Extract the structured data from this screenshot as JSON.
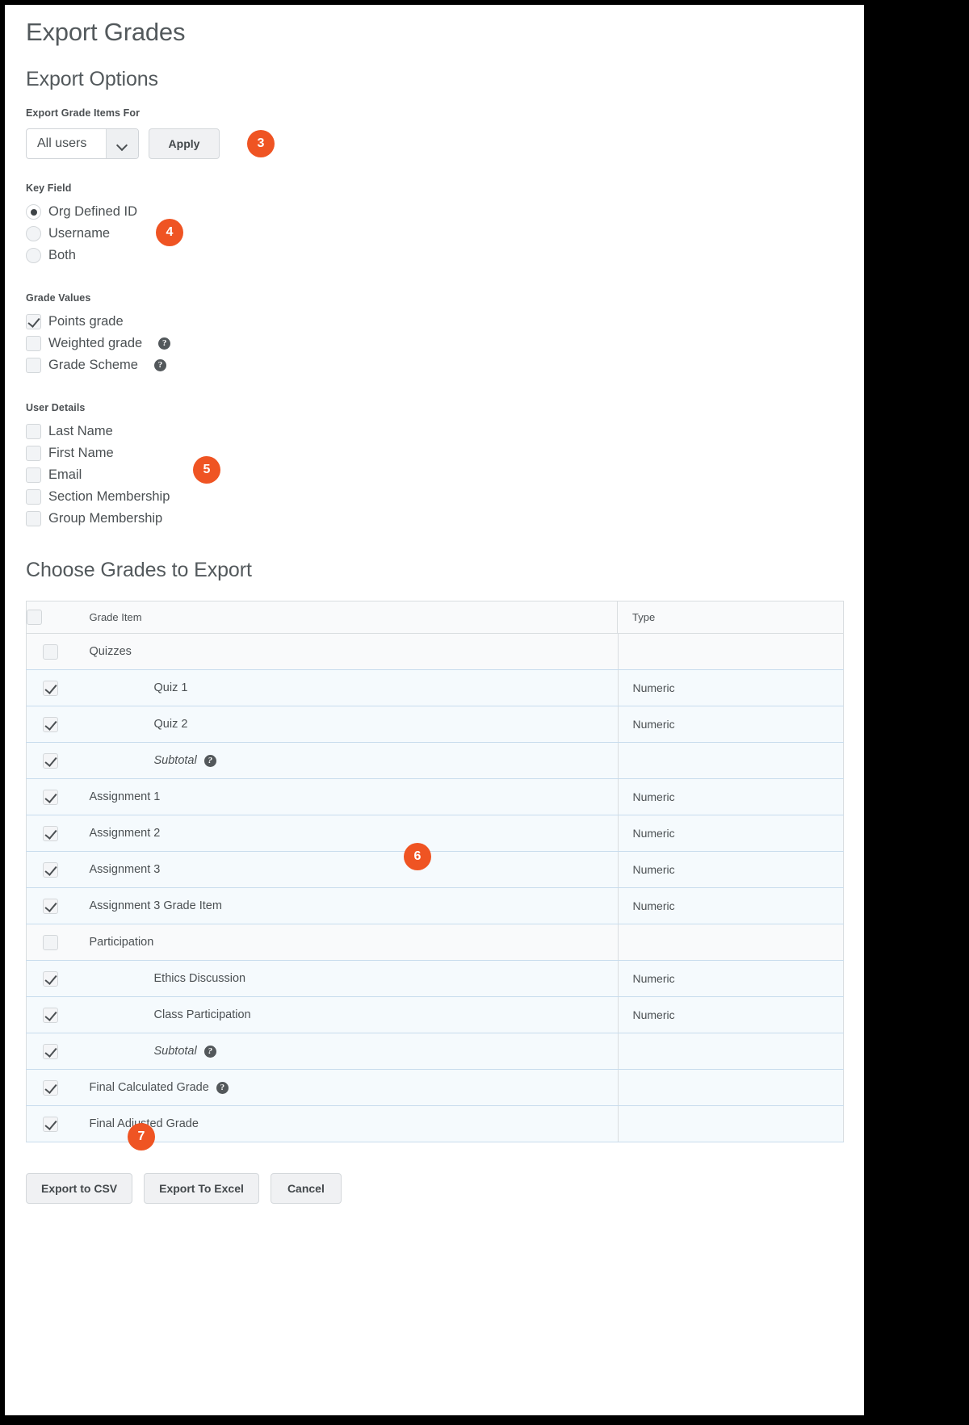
{
  "page": {
    "title": "Export Grades",
    "section_title": "Export Options",
    "choose_title": "Choose Grades to Export"
  },
  "colors": {
    "badge": "#ef5423",
    "text": "#4b5053",
    "row_highlight": "#f5fafd",
    "row_category": "#f9fafb"
  },
  "export_options": {
    "export_for_label": "Export Grade Items For",
    "select_value": "All users",
    "select_options": [
      "All users"
    ],
    "apply_label": "Apply",
    "badge_3": "3",
    "key_field": {
      "label": "Key Field",
      "badge_4": "4",
      "options": [
        {
          "label": "Org Defined ID",
          "selected": true
        },
        {
          "label": "Username",
          "selected": false
        },
        {
          "label": "Both",
          "selected": false
        }
      ]
    },
    "grade_values": {
      "label": "Grade Values",
      "options": [
        {
          "label": "Points grade",
          "checked": true,
          "help": false
        },
        {
          "label": "Weighted grade",
          "checked": false,
          "help": true
        },
        {
          "label": "Grade Scheme",
          "checked": false,
          "help": true
        }
      ]
    },
    "user_details": {
      "label": "User Details",
      "badge_5": "5",
      "options": [
        {
          "label": "Last Name",
          "checked": false
        },
        {
          "label": "First Name",
          "checked": false
        },
        {
          "label": "Email",
          "checked": false
        },
        {
          "label": "Section Membership",
          "checked": false
        },
        {
          "label": "Group Membership",
          "checked": false
        }
      ]
    }
  },
  "grades_table": {
    "badge_6": "6",
    "headers": {
      "check": "",
      "grade_item": "Grade Item",
      "type": "Type"
    },
    "header_check_checked": false,
    "rows": [
      {
        "name": "Quizzes",
        "type": "",
        "checked": false,
        "indent": 0,
        "kind": "category",
        "help": false,
        "italic": false
      },
      {
        "name": "Quiz 1",
        "type": "Numeric",
        "checked": true,
        "indent": 1,
        "kind": "item",
        "help": false,
        "italic": false
      },
      {
        "name": "Quiz 2",
        "type": "Numeric",
        "checked": true,
        "indent": 1,
        "kind": "item",
        "help": false,
        "italic": false
      },
      {
        "name": "Subtotal",
        "type": "",
        "checked": true,
        "indent": 1,
        "kind": "item",
        "help": true,
        "italic": true
      },
      {
        "name": "Assignment 1",
        "type": "Numeric",
        "checked": true,
        "indent": 0,
        "kind": "item",
        "help": false,
        "italic": false
      },
      {
        "name": "Assignment 2",
        "type": "Numeric",
        "checked": true,
        "indent": 0,
        "kind": "item",
        "help": false,
        "italic": false
      },
      {
        "name": "Assignment 3",
        "type": "Numeric",
        "checked": true,
        "indent": 0,
        "kind": "item",
        "help": false,
        "italic": false
      },
      {
        "name": "Assignment 3 Grade Item",
        "type": "Numeric",
        "checked": true,
        "indent": 0,
        "kind": "item",
        "help": false,
        "italic": false
      },
      {
        "name": "Participation",
        "type": "",
        "checked": false,
        "indent": 0,
        "kind": "category",
        "help": false,
        "italic": false
      },
      {
        "name": "Ethics Discussion",
        "type": "Numeric",
        "checked": true,
        "indent": 1,
        "kind": "item",
        "help": false,
        "italic": false
      },
      {
        "name": "Class Participation",
        "type": "Numeric",
        "checked": true,
        "indent": 1,
        "kind": "item",
        "help": false,
        "italic": false
      },
      {
        "name": "Subtotal",
        "type": "",
        "checked": true,
        "indent": 1,
        "kind": "item",
        "help": true,
        "italic": true
      },
      {
        "name": "Final Calculated Grade",
        "type": "",
        "checked": true,
        "indent": 0,
        "kind": "item",
        "help": true,
        "italic": false
      },
      {
        "name": "Final Adjusted Grade",
        "type": "",
        "checked": true,
        "indent": 0,
        "kind": "item",
        "help": false,
        "italic": false
      }
    ]
  },
  "footer": {
    "badge_7": "7",
    "buttons": [
      {
        "label": "Export to CSV"
      },
      {
        "label": "Export To Excel"
      },
      {
        "label": "Cancel"
      }
    ]
  },
  "icons": {
    "help": "?",
    "chevron": "chevron-down-icon"
  }
}
